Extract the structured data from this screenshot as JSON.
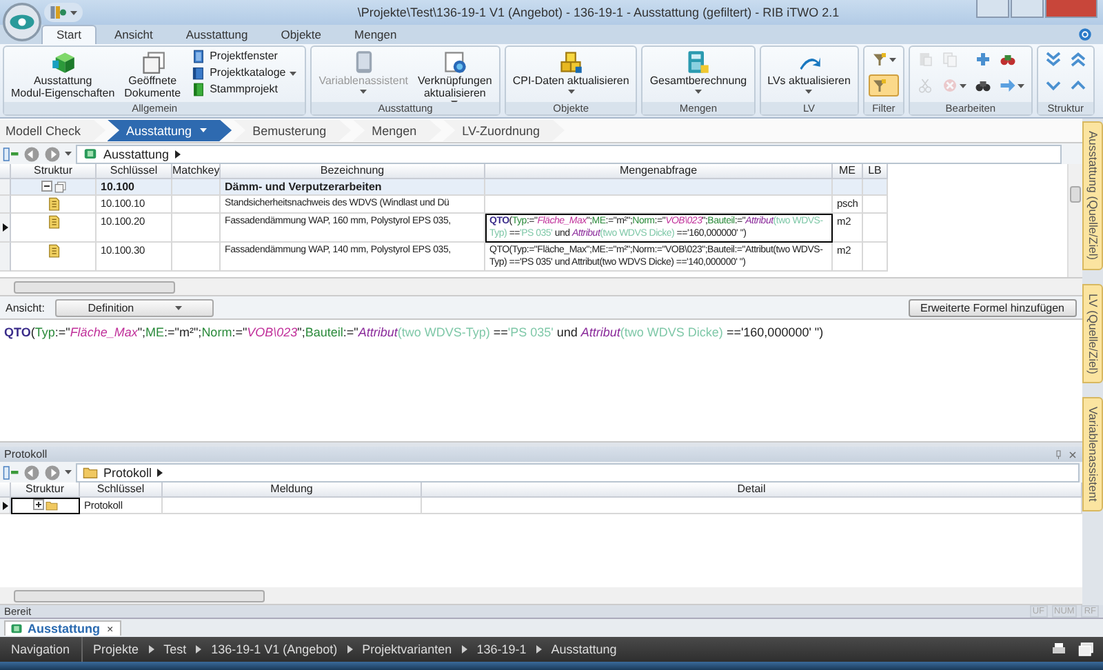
{
  "window": {
    "title": "\\Projekte\\Test\\136-19-1 V1 (Angebot) - 136-19-1 - Ausstattung (gefiltert) - RIB iTWO 2.1"
  },
  "ribbon": {
    "tabs": [
      {
        "label": "Start",
        "selected": true
      },
      {
        "label": "Ansicht",
        "selected": false
      },
      {
        "label": "Ausstattung",
        "selected": false
      },
      {
        "label": "Objekte",
        "selected": false
      },
      {
        "label": "Mengen",
        "selected": false
      }
    ],
    "groups": [
      {
        "title": "Allgemein",
        "items": [
          {
            "kind": "large",
            "label": "Ausstattung\nModul-Eigenschaften",
            "dropdown": false,
            "disabled": false
          },
          {
            "kind": "large",
            "label": "Geöffnete\nDokumente",
            "dropdown": false,
            "disabled": false
          },
          {
            "kind": "small",
            "label": "Projektfenster",
            "dropdown": false,
            "disabled": false
          },
          {
            "kind": "small",
            "label": "Projektkataloge",
            "dropdown": true,
            "disabled": false
          },
          {
            "kind": "small",
            "label": "Stammprojekt",
            "dropdown": false,
            "disabled": false
          }
        ]
      },
      {
        "title": "Ausstattung",
        "items": [
          {
            "kind": "large",
            "label": "Variablenassistent",
            "dropdown": true,
            "disabled": true
          },
          {
            "kind": "large",
            "label": "Verknüpfungen\naktualisieren",
            "dropdown": true,
            "disabled": false
          }
        ]
      },
      {
        "title": "Objekte",
        "items": [
          {
            "kind": "large",
            "label": "CPI-Daten aktualisieren",
            "dropdown": true,
            "disabled": false
          }
        ]
      },
      {
        "title": "Mengen",
        "items": [
          {
            "kind": "large",
            "label": "Gesamtberechnung",
            "dropdown": true,
            "disabled": false
          }
        ]
      },
      {
        "title": "LV",
        "items": [
          {
            "kind": "large",
            "label": "LVs aktualisieren",
            "dropdown": true,
            "disabled": false
          }
        ]
      },
      {
        "title": "Filter",
        "items": [
          {
            "kind": "icon",
            "dropdown": true,
            "disabled": false,
            "on": false
          },
          {
            "kind": "icon",
            "dropdown": false,
            "disabled": false,
            "on": true
          }
        ]
      },
      {
        "title": "Bearbeiten",
        "items": [
          {
            "kind": "icon",
            "dropdown": false,
            "disabled": true,
            "on": false
          },
          {
            "kind": "icon",
            "dropdown": false,
            "disabled": true,
            "on": false
          },
          {
            "kind": "icon",
            "dropdown": false,
            "disabled": true,
            "on": false
          },
          {
            "kind": "icon",
            "dropdown": true,
            "disabled": true,
            "on": false
          },
          {
            "kind": "icon",
            "dropdown": false,
            "disabled": false,
            "on": false
          },
          {
            "kind": "icon",
            "dropdown": false,
            "disabled": false,
            "on": false
          },
          {
            "kind": "icon",
            "dropdown": false,
            "disabled": false,
            "on": false
          },
          {
            "kind": "icon",
            "dropdown": true,
            "disabled": false,
            "on": false
          }
        ]
      },
      {
        "title": "Struktur",
        "items": [
          {
            "kind": "icon",
            "dropdown": false,
            "disabled": false,
            "on": false
          },
          {
            "kind": "icon",
            "dropdown": false,
            "disabled": false,
            "on": false
          },
          {
            "kind": "icon",
            "dropdown": false,
            "disabled": false,
            "on": false
          },
          {
            "kind": "icon",
            "dropdown": false,
            "disabled": false,
            "on": false
          }
        ]
      }
    ]
  },
  "workflow": [
    {
      "label": "Modell Check",
      "selected": false
    },
    {
      "label": "Ausstattung",
      "selected": true
    },
    {
      "label": "Bemusterung",
      "selected": false
    },
    {
      "label": "Mengen",
      "selected": false
    },
    {
      "label": "LV-Zuordnung",
      "selected": false
    }
  ],
  "grid": {
    "path": "Ausstattung",
    "columns": [
      "Struktur",
      "Schlüssel",
      "Matchkey",
      "Bezeichnung",
      "Mengenabfrage",
      "ME",
      "LB"
    ],
    "rows": [
      {
        "kind": "group",
        "selected": false,
        "expanded": true,
        "key": "10.100",
        "name": "Dämm- und Verputzerarbeiten"
      },
      {
        "kind": "item",
        "selected": false,
        "key": "10.100.10",
        "name": "Standsicherheitsnachweis des WDVS (Windlast und Dü",
        "unit": "psch"
      },
      {
        "kind": "item",
        "selected": true,
        "key": "10.100.20",
        "name": "Fassadendämmung WAP, 160 mm, Polystyrol EPS 035,",
        "unit": "m2",
        "query": [
          {
            "kind": "keyword",
            "text": "QTO"
          },
          {
            "kind": "plain",
            "text": "("
          },
          {
            "kind": "param",
            "text": "Typ"
          },
          {
            "kind": "plain",
            "text": ":=\""
          },
          {
            "kind": "string",
            "text": "Fläche_Max"
          },
          {
            "kind": "plain",
            "text": "\";"
          },
          {
            "kind": "param",
            "text": "ME"
          },
          {
            "kind": "plain",
            "text": ":=\"m²\";"
          },
          {
            "kind": "param",
            "text": "Norm"
          },
          {
            "kind": "plain",
            "text": ":=\""
          },
          {
            "kind": "string",
            "text": "VOB\\023"
          },
          {
            "kind": "plain",
            "text": "\";"
          },
          {
            "kind": "param",
            "text": "Bauteil"
          },
          {
            "kind": "plain",
            "text": ":=\""
          },
          {
            "kind": "function",
            "text": "Attribut"
          },
          {
            "kind": "arg",
            "text": "(two WDVS-Typ)"
          },
          {
            "kind": "plain",
            "text": " =="
          },
          {
            "kind": "arg",
            "text": "'PS 035'"
          },
          {
            "kind": "plain",
            "text": " und "
          },
          {
            "kind": "function",
            "text": "Attribut"
          },
          {
            "kind": "arg",
            "text": "(two WDVS Dicke)"
          },
          {
            "kind": "plain",
            "text": " =='160,000000' \")"
          }
        ]
      },
      {
        "kind": "item",
        "selected": false,
        "key": "10.100.30",
        "name": "Fassadendämmung WAP, 140 mm, Polystyrol EPS 035,",
        "unit": "m2",
        "query": [
          {
            "kind": "plain",
            "text": "QTO(Typ:=\"Fläche_Max\";ME:=\"m²\";Norm:=\"VOB\\023\";Bauteil:=\"Attribut(two WDVS-Typ) =='PS 035' und Attribut(two WDVS Dicke) =='140,000000' \")"
          }
        ]
      }
    ]
  },
  "view": {
    "label": "Ansicht:",
    "value": "Definition",
    "button": "Erweiterte Formel hinzufügen"
  },
  "editor": {
    "formula": [
      {
        "kind": "keyword",
        "text": "QTO"
      },
      {
        "kind": "plain",
        "text": "("
      },
      {
        "kind": "param",
        "text": "Typ"
      },
      {
        "kind": "plain",
        "text": ":=\""
      },
      {
        "kind": "string",
        "text": "Fläche_Max"
      },
      {
        "kind": "plain",
        "text": "\";"
      },
      {
        "kind": "param",
        "text": "ME"
      },
      {
        "kind": "plain",
        "text": ":=\"m²\";"
      },
      {
        "kind": "param",
        "text": "Norm"
      },
      {
        "kind": "plain",
        "text": ":=\""
      },
      {
        "kind": "string",
        "text": "VOB\\023"
      },
      {
        "kind": "plain",
        "text": "\";"
      },
      {
        "kind": "param",
        "text": "Bauteil"
      },
      {
        "kind": "plain",
        "text": ":=\""
      },
      {
        "kind": "function",
        "text": "Attribut"
      },
      {
        "kind": "arg",
        "text": "(two WDVS-Typ)"
      },
      {
        "kind": "plain",
        "text": " =="
      },
      {
        "kind": "arg",
        "text": "'PS 035'"
      },
      {
        "kind": "plain",
        "text": " und "
      },
      {
        "kind": "function",
        "text": "Attribut"
      },
      {
        "kind": "arg",
        "text": "(two WDVS Dicke)"
      },
      {
        "kind": "plain",
        "text": " =='160,000000' \")"
      }
    ]
  },
  "protocol": {
    "title": "Protokoll",
    "path": "Protokoll",
    "columns": [
      "Struktur",
      "Schlüssel",
      "Meldung",
      "Detail"
    ],
    "rows": [
      {
        "selected": true,
        "expanded": false,
        "key": "Protokoll"
      }
    ]
  },
  "side_panels": [
    "Ausstattung (Quelle/Ziel)",
    "LV (Quelle/Ziel)",
    "Variablenassistent"
  ],
  "status_bar": {
    "text": "Bereit",
    "indicators": [
      "UF",
      "NUM",
      "RF"
    ]
  },
  "documents": [
    {
      "label": "Ausstattung",
      "close": "×"
    }
  ],
  "navigation": {
    "label": "Navigation",
    "crumbs": [
      "Projekte",
      "Test",
      "136-19-1 V1 (Angebot)",
      "Projektvarianten",
      "136-19-1",
      "Ausstattung"
    ]
  }
}
